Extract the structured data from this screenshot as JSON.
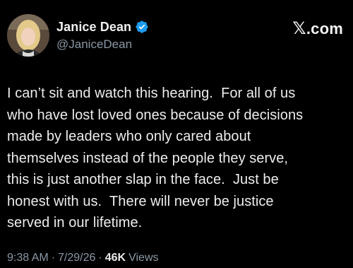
{
  "tweet": {
    "author": {
      "display_name": "Janice Dean",
      "handle": "@JaniceDean",
      "verified": true,
      "avatar": "profile-photo"
    },
    "brand": {
      "label": ".com",
      "logo_icon": "x-logo-icon"
    },
    "text": "I can’t sit and watch this hearing.  For all of us\nwho have lost loved ones because of decisions\nmade by leaders who only cared about\nthemselves instead of the people they serve,\nthis is just another slap in the face.  Just be\nhonest with us.  There will never be justice\nserved in our lifetime.",
    "meta": {
      "time": "9:38 AM",
      "separator": "·",
      "date": "7/29/26",
      "views_count": "46K",
      "views_label": "Views"
    }
  },
  "colors": {
    "background": "#000000",
    "text_primary": "#e7e9ea",
    "text_secondary": "#8b98a5",
    "verified_blue": "#1d9bf0"
  }
}
